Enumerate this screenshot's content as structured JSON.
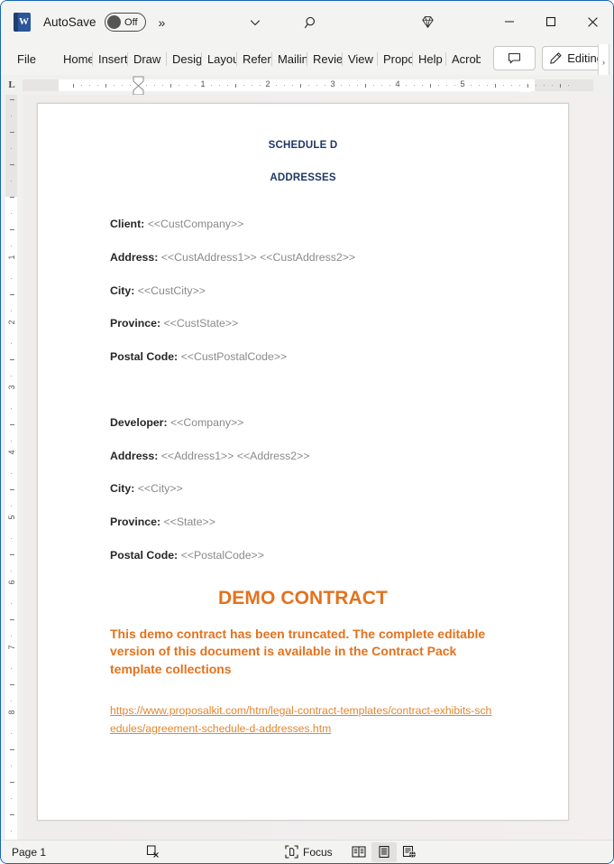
{
  "window": {
    "app_icon": "word-logo",
    "autosave_label": "AutoSave",
    "autosave_state": "Off",
    "more_commands": "»",
    "customize_qat_icon": "chevron-down-icon",
    "search_icon": "search-icon",
    "premium_icon": "diamond-icon",
    "minimize_icon": "minimize-icon",
    "maximize_icon": "maximize-icon",
    "close_icon": "close-icon"
  },
  "ribbon": {
    "tabs": [
      {
        "label": "File",
        "key": "file"
      },
      {
        "label": "Home",
        "key": "home"
      },
      {
        "label": "Insert",
        "key": "insert"
      },
      {
        "label": "Draw",
        "key": "draw"
      },
      {
        "label": "Design",
        "key": "design"
      },
      {
        "label": "Layout",
        "key": "layout"
      },
      {
        "label": "References",
        "key": "references"
      },
      {
        "label": "Mailings",
        "key": "mailings"
      },
      {
        "label": "Review",
        "key": "review"
      },
      {
        "label": "View",
        "key": "view"
      },
      {
        "label": "Proposal",
        "key": "proposal"
      },
      {
        "label": "Help",
        "key": "help"
      },
      {
        "label": "Acrobat",
        "key": "acrobat"
      }
    ],
    "comment_icon": "comment-icon",
    "editing_label": "Editing",
    "editing_icon": "pencil-icon",
    "editing_caret": "ˇ",
    "overflow_caret": "›"
  },
  "ruler": {
    "tab_stop_label": "L",
    "h_numbers": [
      1,
      2,
      3,
      4,
      5
    ],
    "v_numbers": [
      1,
      2,
      3,
      4,
      5,
      6,
      7,
      8
    ]
  },
  "document": {
    "heading1": "SCHEDULE D",
    "heading2": "ADDRESSES",
    "client_block": [
      {
        "label": "Client:",
        "value": "<<CustCompany>>"
      },
      {
        "label": "Address:",
        "value": "<<CustAddress1>> <<CustAddress2>>"
      },
      {
        "label": "City:",
        "value": "<<CustCity>>"
      },
      {
        "label": "Province:",
        "value": "<<CustState>>"
      },
      {
        "label": "Postal Code:",
        "value": "<<CustPostalCode>>"
      }
    ],
    "developer_block": [
      {
        "label": "Developer:",
        "value": "<<Company>>"
      },
      {
        "label": "Address:",
        "value": "<<Address1>> <<Address2>>"
      },
      {
        "label": "City:",
        "value": "<<City>>"
      },
      {
        "label": "Province:",
        "value": "<<State>>"
      },
      {
        "label": "Postal Code:",
        "value": "<<PostalCode>>"
      }
    ],
    "demo_title": "DEMO CONTRACT",
    "demo_body": "This demo contract has been truncated. The complete editable version of this document is available in the Contract Pack template collections",
    "demo_link": "https://www.proposalkit.com/htm/legal-contract-templates/contract-exhibits-schedules/agreement-schedule-d-addresses.htm",
    "colors": {
      "heading": "#1f3864",
      "label": "#262626",
      "placeholder": "#8a8a8a",
      "demo_orange": "#e3721d",
      "link_orange": "#e3862f"
    }
  },
  "statusbar": {
    "page_label": "Page 1",
    "proofing_icon": "proofing-errors-icon",
    "focus_label": "Focus",
    "focus_icon": "focus-icon",
    "view_read": "read-mode-icon",
    "view_print": "print-layout-icon",
    "view_web": "web-layout-icon",
    "active_view": "print-layout-icon"
  }
}
